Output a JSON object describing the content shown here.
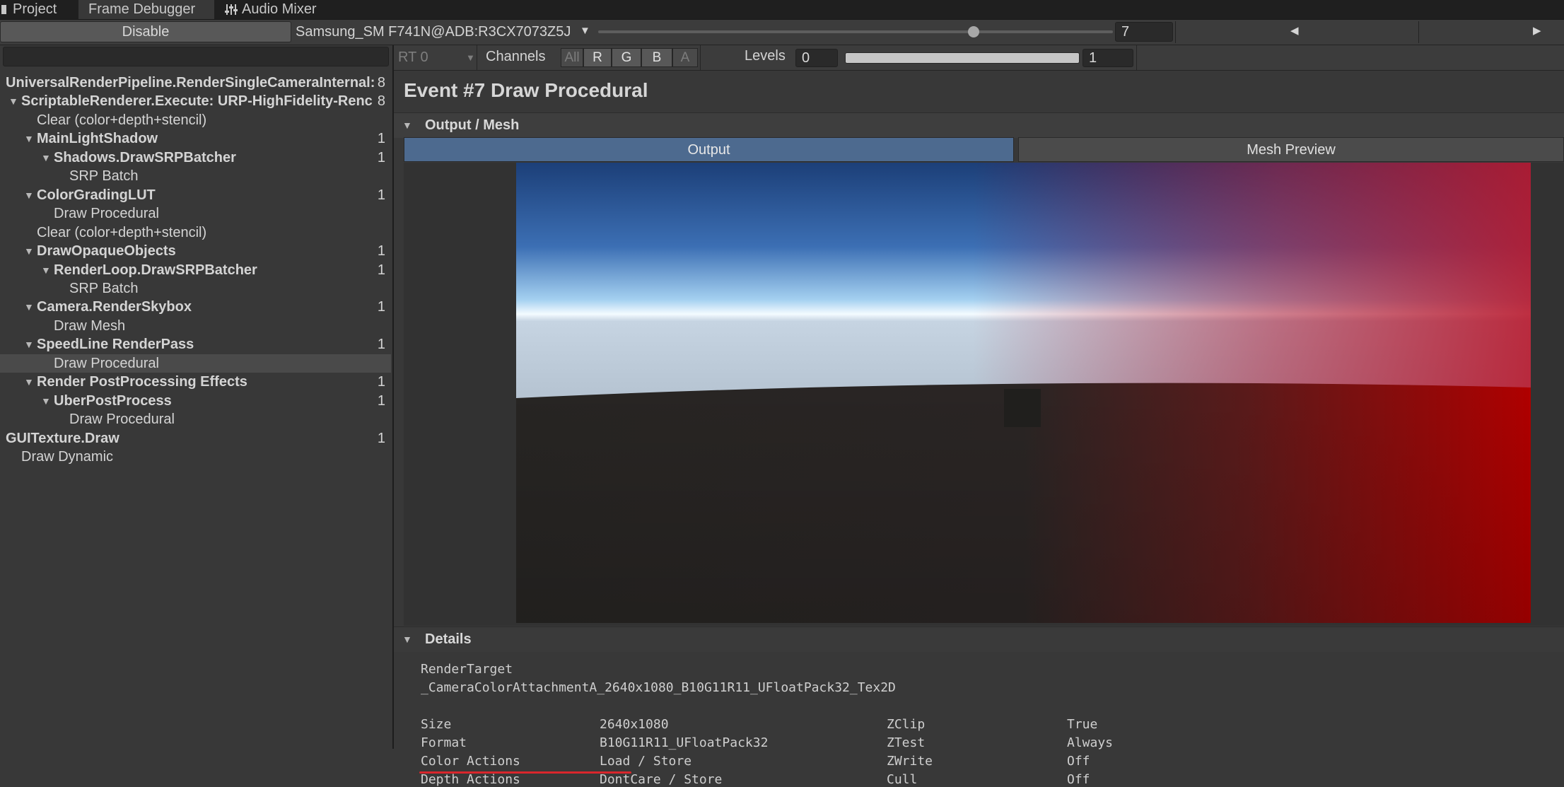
{
  "tabs": [
    {
      "label": "Project",
      "icon": "folder-icon",
      "active": false
    },
    {
      "label": "Frame Debugger",
      "icon": "",
      "active": true
    },
    {
      "label": "Audio Mixer",
      "icon": "sliders-icon",
      "active": false
    }
  ],
  "toolbar": {
    "disable_label": "Disable",
    "device": "Samsung_SM F741N@ADB:R3CX7073Z5J",
    "event_index": "7",
    "event_slider_fraction": 0.73
  },
  "hierarchy": [
    {
      "label": "UniversalRenderPipeline.RenderSingleCameraInternal:",
      "count": "8",
      "bold": true,
      "expandable": false
    },
    {
      "label": "ScriptableRenderer.Execute: URP-HighFidelity-Renc",
      "count": "8",
      "bold": true,
      "expandable": true
    },
    {
      "label": "Clear (color+depth+stencil)",
      "count": "",
      "bold": false,
      "expandable": false
    },
    {
      "label": "MainLightShadow",
      "count": "1",
      "bold": true,
      "expandable": true
    },
    {
      "label": "Shadows.DrawSRPBatcher",
      "count": "1",
      "bold": true,
      "expandable": true
    },
    {
      "label": "SRP Batch",
      "count": "",
      "bold": false,
      "expandable": false
    },
    {
      "label": "ColorGradingLUT",
      "count": "1",
      "bold": true,
      "expandable": true
    },
    {
      "label": "Draw Procedural",
      "count": "",
      "bold": false,
      "expandable": false
    },
    {
      "label": "Clear (color+depth+stencil)",
      "count": "",
      "bold": false,
      "expandable": false
    },
    {
      "label": "DrawOpaqueObjects",
      "count": "1",
      "bold": true,
      "expandable": true
    },
    {
      "label": "RenderLoop.DrawSRPBatcher",
      "count": "1",
      "bold": true,
      "expandable": true
    },
    {
      "label": "SRP Batch",
      "count": "",
      "bold": false,
      "expandable": false
    },
    {
      "label": "Camera.RenderSkybox",
      "count": "1",
      "bold": true,
      "expandable": true
    },
    {
      "label": "Draw Mesh",
      "count": "",
      "bold": false,
      "expandable": false
    },
    {
      "label": "SpeedLine RenderPass",
      "count": "1",
      "bold": true,
      "expandable": true
    },
    {
      "label": "Draw Procedural",
      "count": "",
      "bold": false,
      "expandable": false
    },
    {
      "label": "Render PostProcessing Effects",
      "count": "1",
      "bold": true,
      "expandable": true
    },
    {
      "label": "UberPostProcess",
      "count": "1",
      "bold": true,
      "expandable": true
    },
    {
      "label": "Draw Procedural",
      "count": "",
      "bold": false,
      "expandable": false
    },
    {
      "label": "GUITexture.Draw",
      "count": "1",
      "bold": true,
      "expandable": false
    },
    {
      "label": "Draw Dynamic",
      "count": "",
      "bold": false,
      "expandable": false
    }
  ],
  "selected_index": 15,
  "rt_toolbar": {
    "rt_label": "RT 0",
    "channels_label": "Channels",
    "channel_buttons": [
      "All",
      "R",
      "G",
      "B",
      "A"
    ],
    "levels_label": "Levels",
    "levels_min": "0",
    "levels_max": "1"
  },
  "event_title": "Event #7 Draw Procedural",
  "output_section": {
    "header": "Output / Mesh",
    "tab_output": "Output",
    "tab_mesh_preview": "Mesh Preview"
  },
  "details": {
    "header": "Details",
    "render_target_label": "RenderTarget",
    "render_target_value": "_CameraColorAttachmentA_2640x1080_B10G11R11_UFloatPack32_Tex2D",
    "rows": [
      {
        "k1": "Size",
        "v1": "2640x1080",
        "k2": "ZClip",
        "v2": "True"
      },
      {
        "k1": "Format",
        "v1": "B10G11R11_UFloatPack32",
        "k2": "ZTest",
        "v2": "Always"
      },
      {
        "k1": "Color Actions",
        "v1": "Load / Store",
        "k2": "ZWrite",
        "v2": "Off"
      },
      {
        "k1": "Depth Actions",
        "v1": "DontCare / Store",
        "k2": "Cull",
        "v2": "Off"
      }
    ]
  },
  "colors": {
    "selected_tab": "#4d6a8f",
    "underline": "#d9262c"
  }
}
